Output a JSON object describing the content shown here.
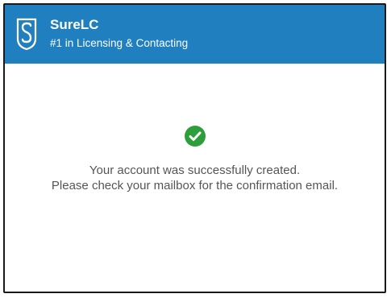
{
  "header": {
    "brand_name": "SureLC",
    "tagline": "#1 in Licensing & Contacting"
  },
  "icons": {
    "logo": "surelc-logo-icon",
    "status": "check-circle-icon"
  },
  "message": {
    "line1": "Your account was successfully created.",
    "line2": "Please check your mailbox for the confirmation email."
  },
  "colors": {
    "header_bg": "#1f7fbf",
    "success": "#2e9e3a",
    "message_text": "#555555"
  }
}
